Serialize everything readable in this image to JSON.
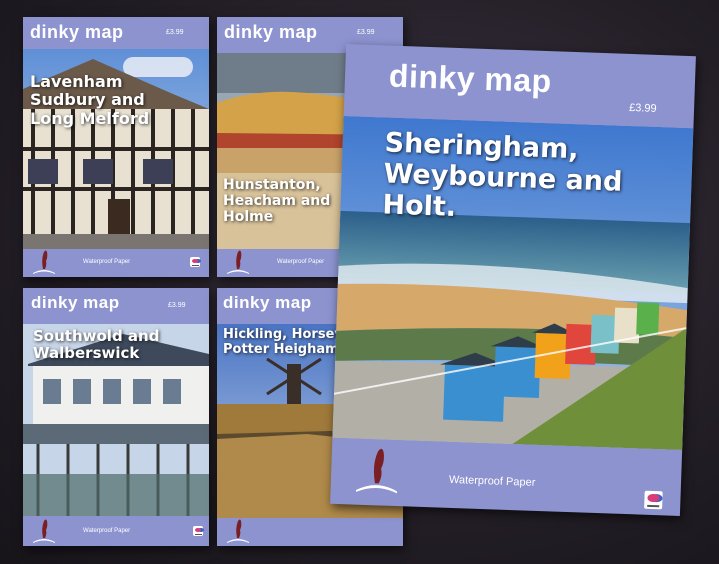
{
  "brand": "dinky map",
  "footer": "Waterproof Paper",
  "maps": [
    {
      "title": "Lavenham Sudbury and Long Melford",
      "price": "£3.99"
    },
    {
      "title": "Hunstanton, Heacham and Holme",
      "price": "£3.99"
    },
    {
      "title": "Southwold and Walberswick",
      "price": "£3.99"
    },
    {
      "title": "Hickling, Horsey Potter Heigham",
      "price": ""
    },
    {
      "title": "Sheringham, Weybourne and Holt.",
      "price": "£3.99"
    }
  ]
}
